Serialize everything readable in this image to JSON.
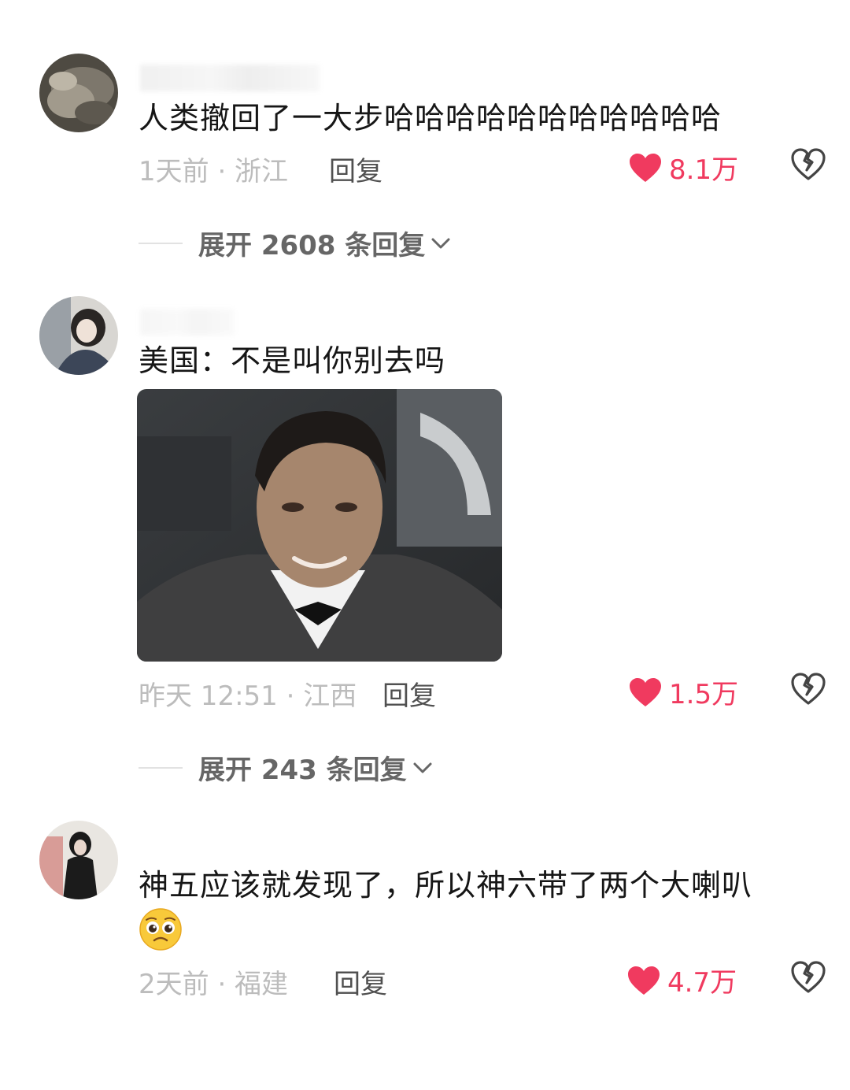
{
  "comments": [
    {
      "text": "人类撤回了一大步哈哈哈哈哈哈哈哈哈哈哈",
      "meta": "1天前 · 浙江",
      "reply_label": "回复",
      "likes": "8.1万",
      "expand_label": "展开 2608 条回复"
    },
    {
      "text": "美国：不是叫你别去吗",
      "meta": "昨天 12:51 · 江西",
      "reply_label": "回复",
      "likes": "1.5万",
      "expand_label": "展开 243 条回复",
      "image_icon": "photo-meme"
    },
    {
      "text": "神五应该就发现了，所以神六带了两个大喇叭",
      "meta": "2天前 · 福建",
      "reply_label": "回复",
      "likes": "4.7万",
      "emoji_icon": "pleading-face-emoji"
    }
  ],
  "colors": {
    "like_red": "#f03a5f",
    "meta_gray": "#bcbcbc",
    "text_dark": "#161616"
  }
}
